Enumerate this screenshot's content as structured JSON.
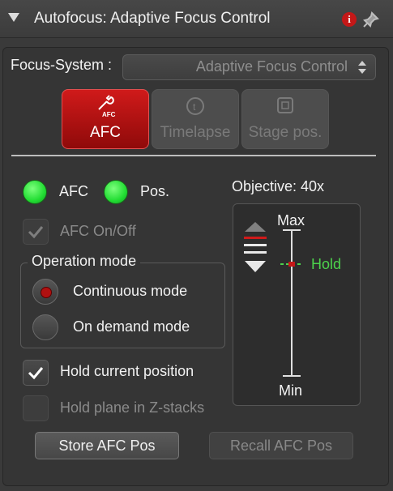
{
  "header": {
    "title": "Autofocus: Adaptive Focus Control",
    "info_icon": "i"
  },
  "focus_system": {
    "label": "Focus-System :",
    "value": "Adaptive Focus Control"
  },
  "modes": [
    {
      "label": "AFC",
      "icon": "afc-wrench-icon",
      "active": true
    },
    {
      "label": "Timelapse",
      "icon": "timelapse-clock-icon",
      "active": false
    },
    {
      "label": "Stage pos.",
      "icon": "stage-position-icon",
      "active": false
    }
  ],
  "indicators": [
    {
      "label": "AFC",
      "color": "#22dd33"
    },
    {
      "label": "Pos.",
      "color": "#22dd33"
    }
  ],
  "afc_onoff": {
    "label": "AFC On/Off",
    "checked": true,
    "enabled": false
  },
  "operation_mode": {
    "legend": "Operation mode",
    "options": [
      {
        "label": "Continuous mode",
        "selected": true
      },
      {
        "label": "On demand mode",
        "selected": false
      }
    ]
  },
  "hold_current": {
    "label": "Hold current position",
    "checked": true,
    "enabled": true
  },
  "hold_plane": {
    "label": "Hold plane in Z-stacks",
    "checked": false,
    "enabled": false
  },
  "objective": {
    "label": "Objective: 40x",
    "max_label": "Max",
    "min_label": "Min",
    "hold_label": "Hold",
    "hold_color": "#4cd44c"
  },
  "buttons": {
    "store": "Store AFC Pos",
    "recall": "Recall AFC Pos"
  },
  "colors": {
    "accent_red": "#c41818",
    "led_green": "#22dd33"
  }
}
